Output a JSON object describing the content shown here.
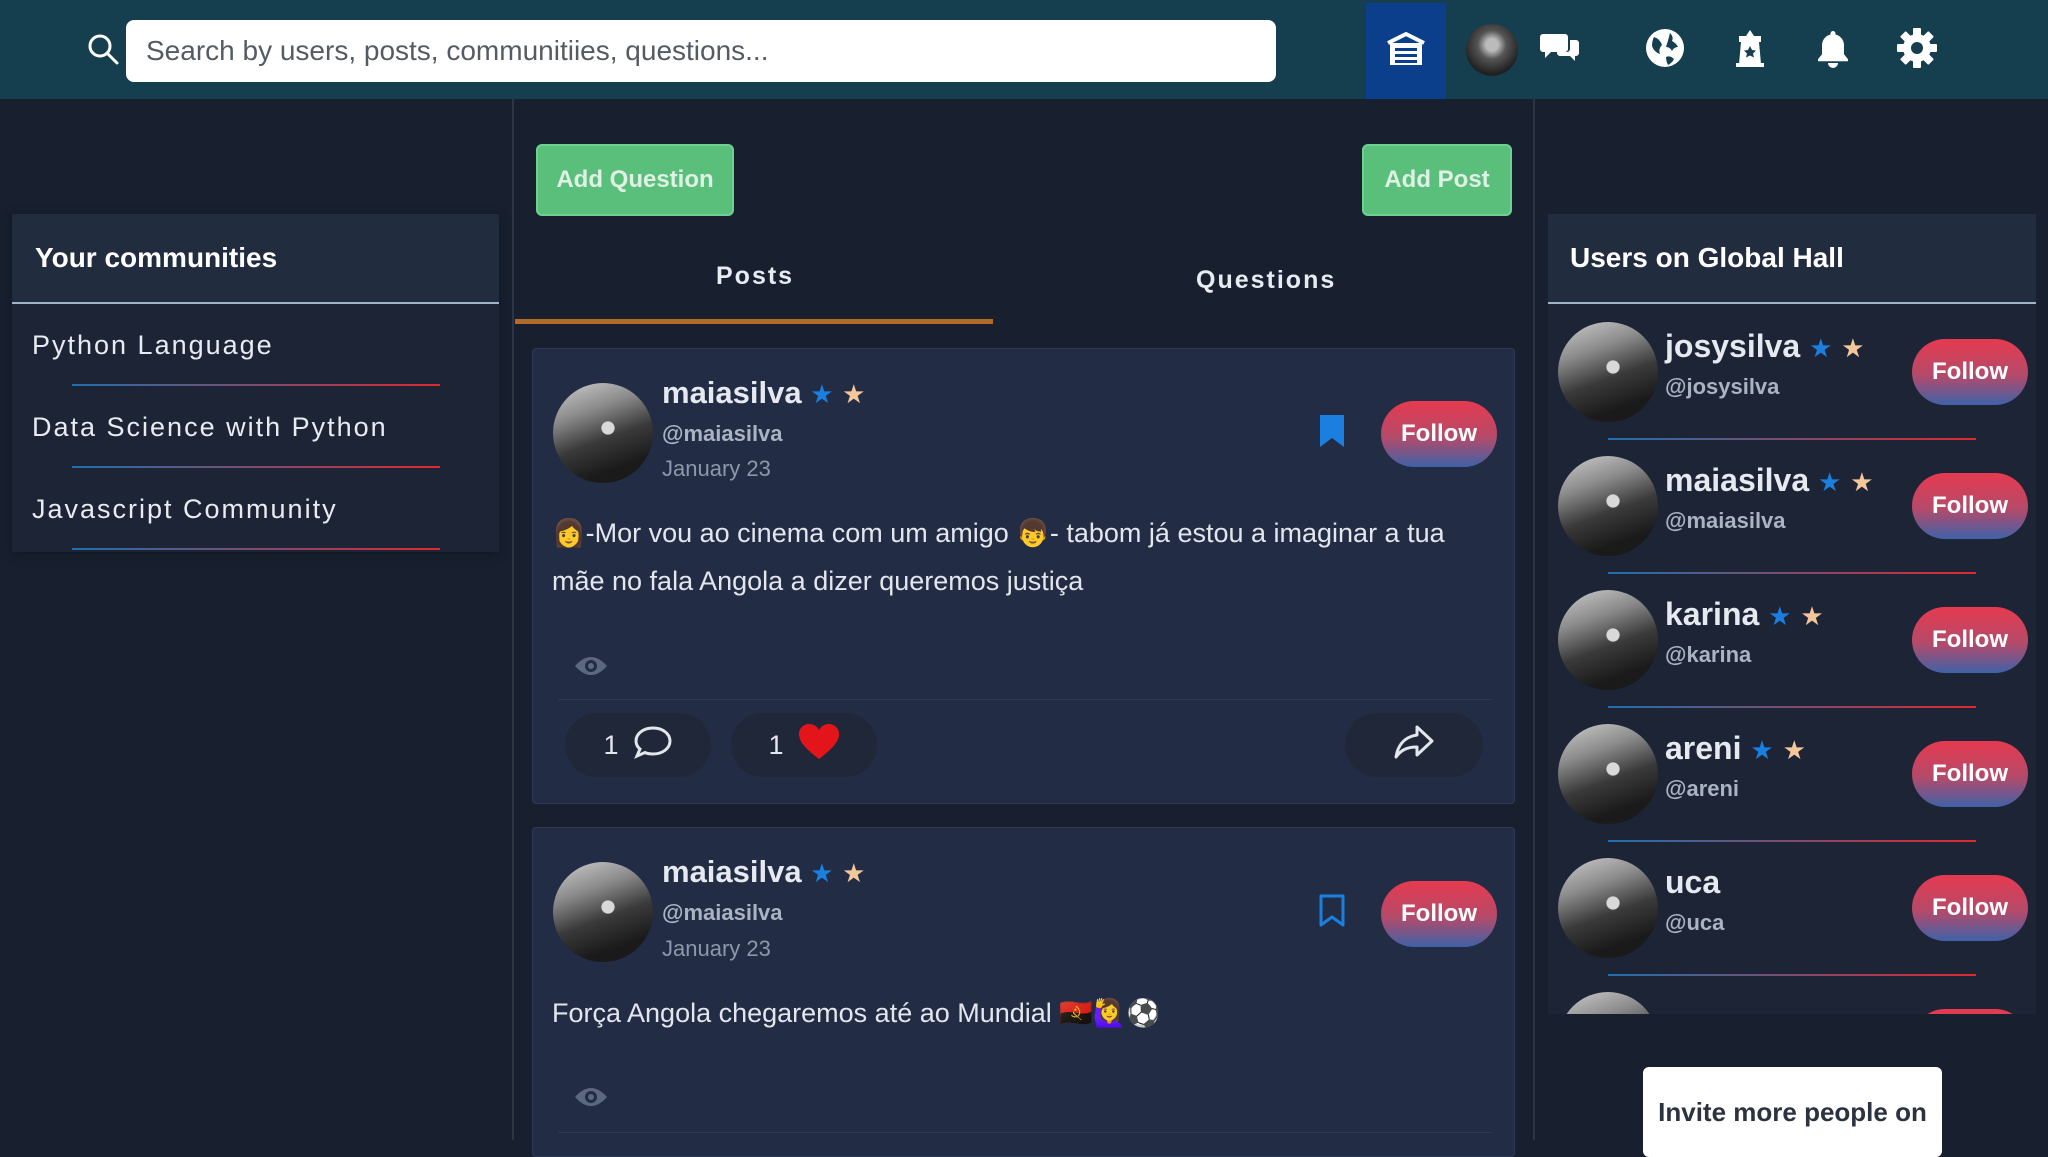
{
  "header": {
    "search": {
      "placeholder": "Search by users, posts, communitiies, questions..."
    },
    "icons": [
      "search-icon",
      "home-icon",
      "avatar",
      "messages-icon",
      "globe-icon",
      "tower-icon",
      "bell-icon",
      "gear-icon"
    ]
  },
  "sidebar": {
    "title": "Your communities",
    "items": [
      {
        "label": "Python Language"
      },
      {
        "label": "Data Science with Python"
      },
      {
        "label": "Javascript Community"
      }
    ]
  },
  "main": {
    "add_question_label": "Add Question",
    "add_post_label": "Add Post",
    "tabs": [
      {
        "label": "Posts"
      },
      {
        "label": "Questions"
      }
    ],
    "active_tab": "Posts",
    "posts": [
      {
        "name": "maiasilva",
        "handle": "@maiasilva",
        "date": "January 23",
        "follow_label": "Follow",
        "bookmarked": true,
        "text": "👩-Mor vou ao cinema com um amigo 👦- tabom já estou a imaginar a tua mãe no fala Angola a dizer queremos justiça",
        "comments": "1",
        "likes": "1"
      },
      {
        "name": "maiasilva",
        "handle": "@maiasilva",
        "date": "January 23",
        "follow_label": "Follow",
        "bookmarked": false,
        "text": "Força Angola chegaremos até ao Mundial 🇦🇴🙋‍♀️⚽"
      }
    ]
  },
  "right_panel": {
    "title": "Users on Global Hall",
    "users": [
      {
        "name": "josysilva",
        "handle": "@josysilva",
        "stars": true,
        "follow_label": "Follow"
      },
      {
        "name": "maiasilva",
        "handle": "@maiasilva",
        "stars": true,
        "follow_label": "Follow"
      },
      {
        "name": "karina",
        "handle": "@karina",
        "stars": true,
        "follow_label": "Follow"
      },
      {
        "name": "areni",
        "handle": "@areni",
        "stars": true,
        "follow_label": "Follow"
      },
      {
        "name": "uca",
        "handle": "@uca",
        "stars": false,
        "follow_label": "Follow"
      }
    ],
    "invite_label": "Invite more people on"
  },
  "colors": {
    "topbar": "#153e4f",
    "background": "#182030",
    "card": "#222c45",
    "accent_green": "#5bbf7c",
    "tab_underline": "#b06a2a",
    "bookmark": "#1b7fe0",
    "heart": "#e3151a"
  }
}
